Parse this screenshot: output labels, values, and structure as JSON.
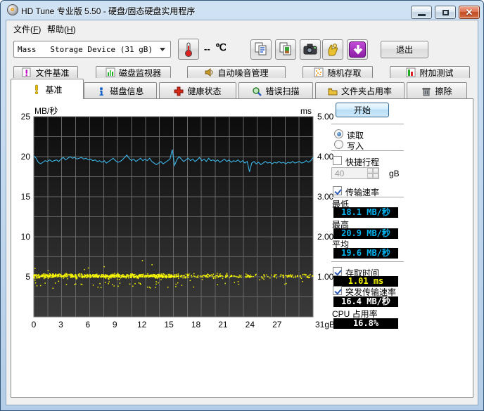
{
  "window": {
    "title": "HD Tune 专业版 5.50 - 硬盘/固态硬盘实用程序"
  },
  "menu": {
    "items": [
      {
        "pre": "文件(",
        "key": "F",
        "post": ")"
      },
      {
        "pre": "帮助(",
        "key": "H",
        "post": ")"
      }
    ]
  },
  "toolbar": {
    "device_select": "Mass   Storage Device (31 gB)",
    "temp_value": "--",
    "temp_unit": "℃",
    "exit_label": "退出"
  },
  "tabs_top": [
    {
      "label": "文件基准",
      "icon": "file-benchmark-icon"
    },
    {
      "label": "磁盘监视器",
      "icon": "disk-monitor-icon"
    },
    {
      "label": "自动噪音管理",
      "icon": "aam-icon"
    },
    {
      "label": "随机存取",
      "icon": "random-access-icon"
    },
    {
      "label": "附加测试",
      "icon": "extra-tests-icon"
    }
  ],
  "tabs_main": [
    {
      "label": "基准",
      "icon": "benchmark-icon",
      "selected": true
    },
    {
      "label": "磁盘信息",
      "icon": "disk-info-icon"
    },
    {
      "label": "健康状态",
      "icon": "health-icon"
    },
    {
      "label": "错误扫描",
      "icon": "error-scan-icon"
    },
    {
      "label": "文件夹占用率",
      "icon": "folder-usage-icon"
    },
    {
      "label": "擦除",
      "icon": "erase-icon"
    }
  ],
  "panel": {
    "start_button": "开始",
    "radio_read": "读取",
    "radio_write": "写入",
    "checkbox_short_stroke": "快捷行程",
    "stroke_value": "40",
    "stroke_unit": "gB",
    "checkbox_transfer": "传输速率",
    "min_label": "最低",
    "min_value": "18.1 MB/秒",
    "max_label": "最高",
    "max_value": "20.9 MB/秒",
    "avg_label": "平均",
    "avg_value": "19.6 MB/秒",
    "checkbox_access": "存取时间",
    "access_value": "1.01 ms",
    "checkbox_burst": "突发传输速率",
    "burst_value": "16.4 MB/秒",
    "cpu_label": "CPU 占用率",
    "cpu_value": "16.8%"
  },
  "colors": {
    "transfer_line": "#3cb4e6",
    "access_dots": "#f8f800",
    "value_cyan": "#00b4f0",
    "value_yellow": "#f8f800",
    "value_white": "#ffffff"
  },
  "chart_data": {
    "type": "line+scatter",
    "title": "",
    "xlabel_end": "31gB",
    "ylabel_left": "MB/秒",
    "ylabel_right": "ms",
    "xlim": [
      0,
      31
    ],
    "ylim_left": [
      0,
      25
    ],
    "ylim_right": [
      0,
      5
    ],
    "x_ticks": [
      0,
      3,
      6,
      9,
      12,
      15,
      18,
      21,
      24,
      27
    ],
    "left_ticks": [
      5,
      10,
      15,
      20,
      25
    ],
    "right_ticks": [
      "1.00",
      "2.00",
      "3.00",
      "4.00",
      "5.00"
    ],
    "grid": true,
    "series": [
      {
        "name": "transfer_rate_read",
        "unit": "MB/s",
        "min": 18.1,
        "max": 20.9,
        "avg": 19.6,
        "values": [
          20.1,
          19.8,
          19.3,
          19.1,
          19.3,
          19.5,
          19.4,
          19.6,
          19.4,
          19.5,
          19.6,
          19.4,
          19.7,
          19.9,
          19.6,
          19.8,
          20.0,
          19.8,
          19.9,
          19.7,
          19.8,
          19.9,
          19.7,
          19.8,
          19.6,
          19.7,
          19.5,
          19.6,
          19.4,
          19.5,
          19.3,
          19.5,
          19.2,
          19.4,
          19.6,
          19.8,
          19.5,
          19.3,
          19.4,
          19.6,
          19.9,
          20.2,
          19.8,
          19.5,
          19.7,
          19.4,
          19.6,
          19.8,
          19.5,
          19.7,
          19.5,
          19.8,
          19.4,
          19.2,
          19.0,
          19.2,
          19.4,
          19.1,
          19.3,
          19.5,
          19.7,
          20.9,
          18.9,
          19.6,
          20.0,
          19.7,
          19.4,
          19.6,
          19.8,
          19.5,
          19.7,
          19.4,
          19.6,
          19.9,
          19.5,
          19.7,
          19.4,
          19.8,
          19.5,
          19.6,
          19.4,
          19.6,
          19.3,
          19.5,
          19.7,
          19.4,
          19.6,
          19.3,
          19.5,
          19.4,
          19.6,
          19.3,
          19.5,
          19.2,
          19.4,
          18.1,
          19.2,
          19.4,
          19.1,
          19.3,
          19.0,
          19.2,
          19.4,
          19.2,
          19.3,
          19.1,
          19.3,
          19.2,
          19.4,
          19.2,
          19.3,
          19.1,
          19.3,
          19.2,
          19.4,
          19.2,
          19.3,
          19.4,
          19.2,
          19.3,
          19.5,
          19.3,
          19.5,
          19.9
        ]
      }
    ],
    "scatter": {
      "name": "access_time",
      "unit": "ms",
      "displayed_value": 1.01,
      "mean": 1.02,
      "count": 1000,
      "seed": 11
    }
  }
}
